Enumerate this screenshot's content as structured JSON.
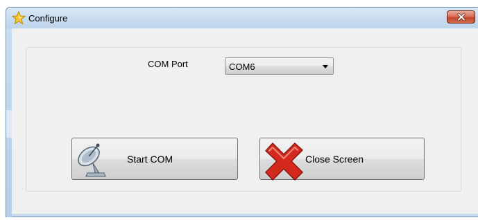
{
  "window": {
    "title": "Configure",
    "app_icon": "star-icon",
    "close_icon": "close-icon"
  },
  "form": {
    "com_port_label": "COM Port",
    "com_port_value": "COM6"
  },
  "buttons": {
    "start_label": "Start COM",
    "start_icon": "satellite-dish-icon",
    "close_label": "Close Screen",
    "close_icon": "red-x-icon"
  },
  "colors": {
    "title_bar": "#c8dcf0",
    "client_background": "#f0f0f0",
    "close_button": "#c3472b",
    "x_icon": "#d42a1e"
  }
}
